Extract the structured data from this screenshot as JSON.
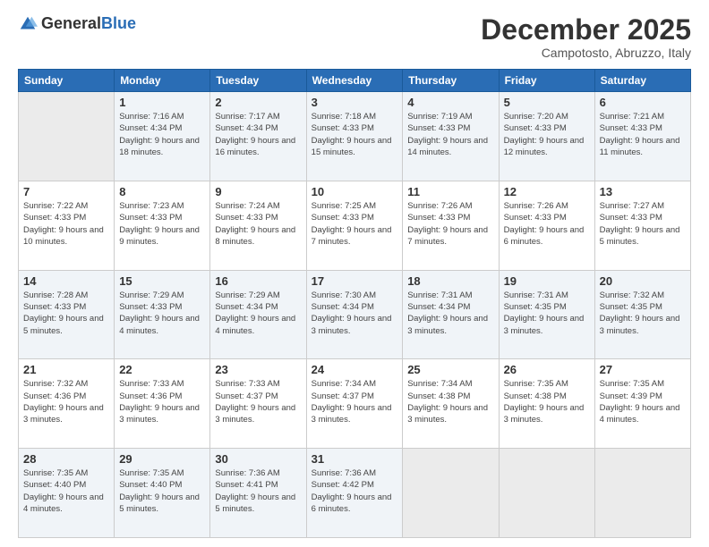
{
  "logo": {
    "general": "General",
    "blue": "Blue"
  },
  "header": {
    "month": "December 2025",
    "location": "Campotosto, Abruzzo, Italy"
  },
  "weekdays": [
    "Sunday",
    "Monday",
    "Tuesday",
    "Wednesday",
    "Thursday",
    "Friday",
    "Saturday"
  ],
  "weeks": [
    [
      {
        "day": null,
        "sunrise": "",
        "sunset": "",
        "daylight": ""
      },
      {
        "day": "1",
        "sunrise": "7:16 AM",
        "sunset": "4:34 PM",
        "daylight": "9 hours and 18 minutes."
      },
      {
        "day": "2",
        "sunrise": "7:17 AM",
        "sunset": "4:34 PM",
        "daylight": "9 hours and 16 minutes."
      },
      {
        "day": "3",
        "sunrise": "7:18 AM",
        "sunset": "4:33 PM",
        "daylight": "9 hours and 15 minutes."
      },
      {
        "day": "4",
        "sunrise": "7:19 AM",
        "sunset": "4:33 PM",
        "daylight": "9 hours and 14 minutes."
      },
      {
        "day": "5",
        "sunrise": "7:20 AM",
        "sunset": "4:33 PM",
        "daylight": "9 hours and 12 minutes."
      },
      {
        "day": "6",
        "sunrise": "7:21 AM",
        "sunset": "4:33 PM",
        "daylight": "9 hours and 11 minutes."
      }
    ],
    [
      {
        "day": "7",
        "sunrise": "7:22 AM",
        "sunset": "4:33 PM",
        "daylight": "9 hours and 10 minutes."
      },
      {
        "day": "8",
        "sunrise": "7:23 AM",
        "sunset": "4:33 PM",
        "daylight": "9 hours and 9 minutes."
      },
      {
        "day": "9",
        "sunrise": "7:24 AM",
        "sunset": "4:33 PM",
        "daylight": "9 hours and 8 minutes."
      },
      {
        "day": "10",
        "sunrise": "7:25 AM",
        "sunset": "4:33 PM",
        "daylight": "9 hours and 7 minutes."
      },
      {
        "day": "11",
        "sunrise": "7:26 AM",
        "sunset": "4:33 PM",
        "daylight": "9 hours and 7 minutes."
      },
      {
        "day": "12",
        "sunrise": "7:26 AM",
        "sunset": "4:33 PM",
        "daylight": "9 hours and 6 minutes."
      },
      {
        "day": "13",
        "sunrise": "7:27 AM",
        "sunset": "4:33 PM",
        "daylight": "9 hours and 5 minutes."
      }
    ],
    [
      {
        "day": "14",
        "sunrise": "7:28 AM",
        "sunset": "4:33 PM",
        "daylight": "9 hours and 5 minutes."
      },
      {
        "day": "15",
        "sunrise": "7:29 AM",
        "sunset": "4:33 PM",
        "daylight": "9 hours and 4 minutes."
      },
      {
        "day": "16",
        "sunrise": "7:29 AM",
        "sunset": "4:34 PM",
        "daylight": "9 hours and 4 minutes."
      },
      {
        "day": "17",
        "sunrise": "7:30 AM",
        "sunset": "4:34 PM",
        "daylight": "9 hours and 3 minutes."
      },
      {
        "day": "18",
        "sunrise": "7:31 AM",
        "sunset": "4:34 PM",
        "daylight": "9 hours and 3 minutes."
      },
      {
        "day": "19",
        "sunrise": "7:31 AM",
        "sunset": "4:35 PM",
        "daylight": "9 hours and 3 minutes."
      },
      {
        "day": "20",
        "sunrise": "7:32 AM",
        "sunset": "4:35 PM",
        "daylight": "9 hours and 3 minutes."
      }
    ],
    [
      {
        "day": "21",
        "sunrise": "7:32 AM",
        "sunset": "4:36 PM",
        "daylight": "9 hours and 3 minutes."
      },
      {
        "day": "22",
        "sunrise": "7:33 AM",
        "sunset": "4:36 PM",
        "daylight": "9 hours and 3 minutes."
      },
      {
        "day": "23",
        "sunrise": "7:33 AM",
        "sunset": "4:37 PM",
        "daylight": "9 hours and 3 minutes."
      },
      {
        "day": "24",
        "sunrise": "7:34 AM",
        "sunset": "4:37 PM",
        "daylight": "9 hours and 3 minutes."
      },
      {
        "day": "25",
        "sunrise": "7:34 AM",
        "sunset": "4:38 PM",
        "daylight": "9 hours and 3 minutes."
      },
      {
        "day": "26",
        "sunrise": "7:35 AM",
        "sunset": "4:38 PM",
        "daylight": "9 hours and 3 minutes."
      },
      {
        "day": "27",
        "sunrise": "7:35 AM",
        "sunset": "4:39 PM",
        "daylight": "9 hours and 4 minutes."
      }
    ],
    [
      {
        "day": "28",
        "sunrise": "7:35 AM",
        "sunset": "4:40 PM",
        "daylight": "9 hours and 4 minutes."
      },
      {
        "day": "29",
        "sunrise": "7:35 AM",
        "sunset": "4:40 PM",
        "daylight": "9 hours and 5 minutes."
      },
      {
        "day": "30",
        "sunrise": "7:36 AM",
        "sunset": "4:41 PM",
        "daylight": "9 hours and 5 minutes."
      },
      {
        "day": "31",
        "sunrise": "7:36 AM",
        "sunset": "4:42 PM",
        "daylight": "9 hours and 6 minutes."
      },
      {
        "day": null,
        "sunrise": "",
        "sunset": "",
        "daylight": ""
      },
      {
        "day": null,
        "sunrise": "",
        "sunset": "",
        "daylight": ""
      },
      {
        "day": null,
        "sunrise": "",
        "sunset": "",
        "daylight": ""
      }
    ]
  ],
  "labels": {
    "sunrise": "Sunrise:",
    "sunset": "Sunset:",
    "daylight": "Daylight:"
  }
}
